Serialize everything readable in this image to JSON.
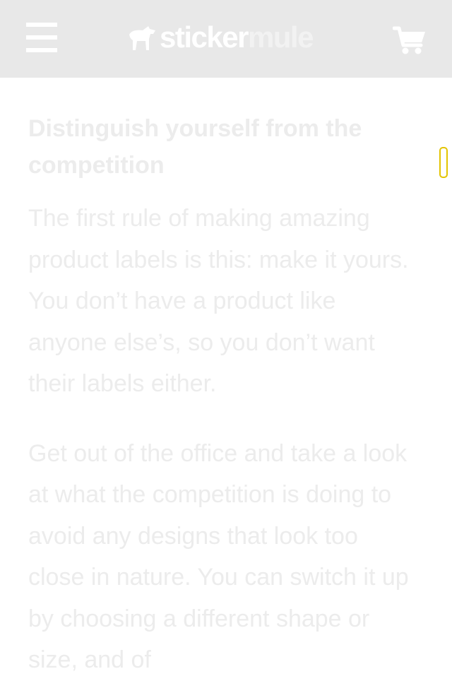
{
  "header": {
    "menu_icon": "hamburger-menu-icon",
    "logo": {
      "part1": "sticker",
      "part2": "mule",
      "mark_icon": "mule-logo-icon"
    },
    "cart_icon": "shopping-cart-icon",
    "colors": {
      "bar": "#e8e8e8",
      "icon": "#ffffff"
    }
  },
  "article": {
    "heading": "Distinguish yourself from the competition",
    "paragraphs": [
      "The first rule of making amazing product labels is this: make it yours. You don’t have a product like anyone else’s, so you don’t want their labels either.",
      "Get out of the office and take a look at what the competition is doing to avoid any designs that look too close in nature. You can switch it up by choosing a different shape or size, and of"
    ],
    "text_color": "#ececec"
  },
  "scroll_marker": {
    "border_color": "#e3c400"
  }
}
